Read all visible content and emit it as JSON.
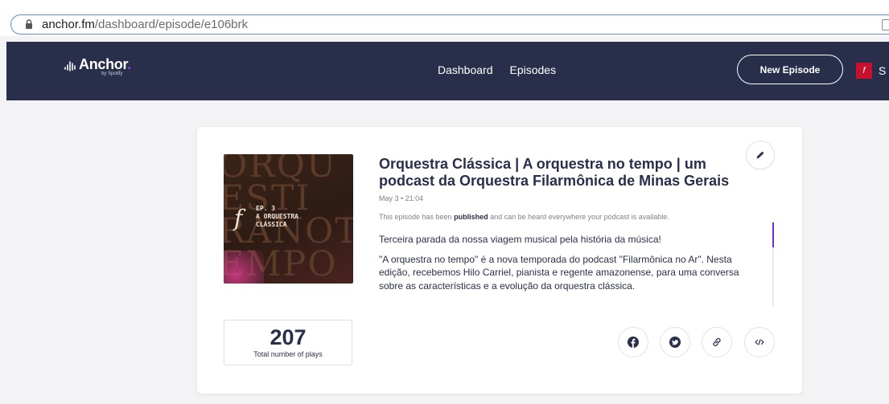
{
  "browser": {
    "url_host": "anchor.fm",
    "url_path": "/dashboard/episode/e106brk"
  },
  "nav": {
    "logo_text": "Anchor",
    "logo_dot": ".",
    "logo_sub": "by Spotify",
    "links": [
      "Dashboard",
      "Episodes"
    ],
    "new_episode_label": "New Episode",
    "avatar_glyph": "f",
    "cut_text": "S"
  },
  "episode": {
    "cover": {
      "bg_text": "ORQU\nESTI\nRANOT\nEMPO",
      "f_glyph": "f",
      "ep_lines": "EP. 3\nA ORQUESTRA\nCLÁSSICA"
    },
    "title": "Orquestra Clássica | A orquestra no tempo | um podcast da Orquestra Filarmônica de Minas Gerais",
    "date": "May 3 • 21:04",
    "status_prefix": "This episode has been ",
    "status_bold": "published",
    "status_suffix": " and can be heard everywhere your podcast is available.",
    "description": [
      "Terceira parada da nossa viagem musical pela história da música!",
      "\"A orquestra no tempo\" é a nova temporada do podcast \"Filarmônica no Ar\". Nesta edição, recebemos Hilo Carriel, pianista e regente amazonense, para uma conversa sobre as características e a evolução da orquestra clássica."
    ],
    "plays_count": "207",
    "plays_label": "Total number of plays"
  },
  "colors": {
    "nav_bg": "#292f4b",
    "accent": "#6d2dd2",
    "text_dark": "#292f4b"
  },
  "icons": {
    "lock": "lock-icon",
    "edit": "pencil-icon",
    "share": [
      "facebook-icon",
      "twitter-icon",
      "link-icon",
      "embed-code-icon"
    ]
  }
}
